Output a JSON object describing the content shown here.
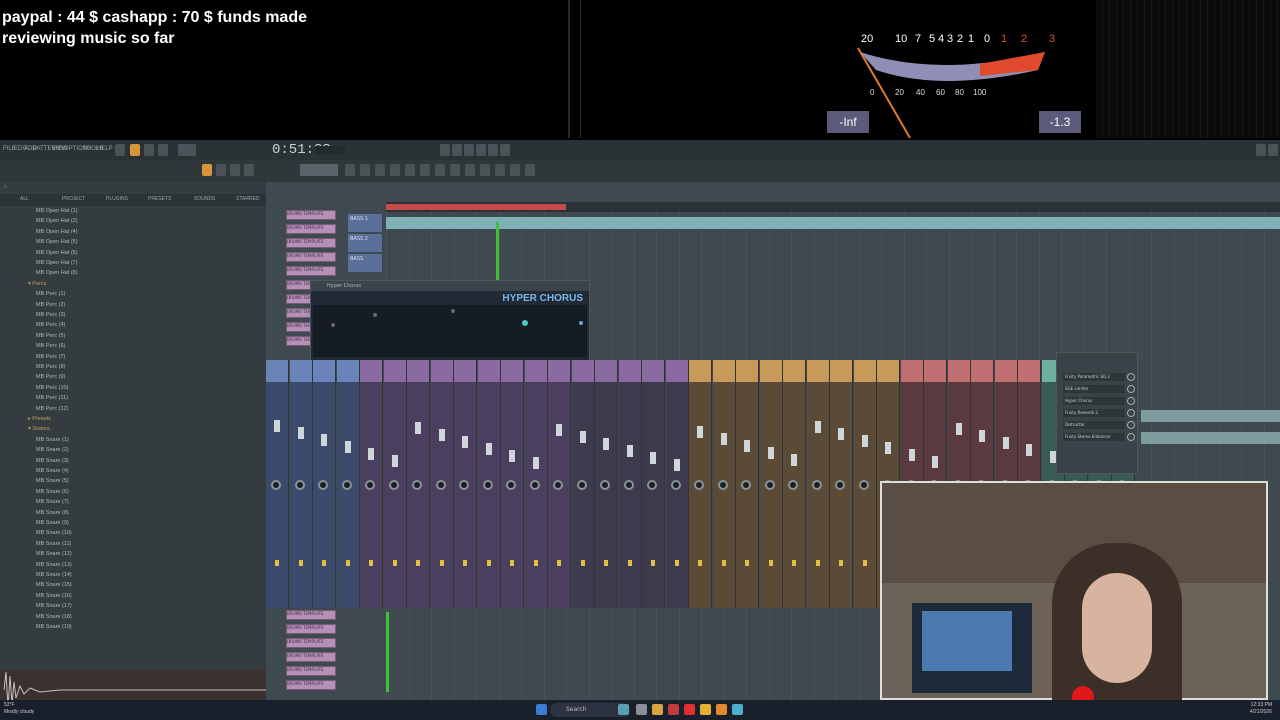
{
  "stream": {
    "funds_line1": "paypal : 44 $  cashapp : 70 $ funds made",
    "funds_line2": "reviewing music so far"
  },
  "vu_meter": {
    "scale_top": [
      "20",
      "10",
      "7",
      "5",
      "4",
      "3",
      "2",
      "1",
      "0",
      "1",
      "2",
      "3"
    ],
    "scale_bottom": [
      "0",
      "20",
      "40",
      "60",
      "80",
      "100"
    ],
    "left_readout": "-Inf",
    "right_readout": "-1.3",
    "needle_color": "#e07a2a"
  },
  "fl": {
    "menu": [
      "FILE",
      "EDIT",
      "ADD",
      "PATTERNS",
      "VIEW",
      "OPTIONS",
      "TOOLS",
      "HELP"
    ],
    "time": "0:51:??",
    "browser": {
      "tabs": [
        "ALL",
        "PROJECT",
        "PLUGINS",
        "PRESETS",
        "SOUNDS",
        "STARRED"
      ],
      "items_top": [
        "MB Open Hat (1)",
        "MB Open Hat (2)",
        "MB Open Hat (4)",
        "MB Open Hat (5)",
        "MB Open Hat (6)",
        "MB Open Hat (7)",
        "MB Open Hat (8)"
      ],
      "folder_percs": "Percs",
      "percs": [
        "MB Perc (1)",
        "MB Perc (2)",
        "MB Perc (3)",
        "MB Perc (4)",
        "MB Perc (5)",
        "MB Perc (6)",
        "MB Perc (7)",
        "MB Perc (8)",
        "MB Perc (9)",
        "MB Perc (10)",
        "MB Perc (11)",
        "MB Perc (12)"
      ],
      "folder_presets": "Presets",
      "folder_snares": "Snares",
      "snares": [
        "MB Snare (1)",
        "MB Snare (2)",
        "MB Snare (3)",
        "MB Snare (4)",
        "MB Snare (5)",
        "MB Snare (6)",
        "MB Snare (7)",
        "MB Snare (8)",
        "MB Snare (9)",
        "MB Snare (10)",
        "MB Snare (11)",
        "MB Snare (12)",
        "MB Snare (13)",
        "MB Snare (14)",
        "MB Snare (15)",
        "MB Snare (16)",
        "MB Snare (17)",
        "MB Snare (18)",
        "MB Snare (19)"
      ]
    },
    "playlist": {
      "track_labels": [
        "BASS 1",
        "BASS 2",
        "BASS"
      ],
      "clip_label": "DRUMS TEMPLATE"
    },
    "hyper_chorus": {
      "window_title": "Hyper Chorus",
      "plugin_title": "HYPER CHORUS"
    },
    "fx_rack": {
      "slots": [
        "Fruity Parametric EQ 2",
        "SGE Limiter",
        "Hyper Chorus",
        "Fruity Reeverb 2",
        "Distructor",
        "Fruity Stereo Enhancer"
      ]
    }
  },
  "taskbar": {
    "weather": "53°F",
    "weather_sub": "Mostly cloudy",
    "search": "Search",
    "time": "12:33 PM",
    "date": "4/21/2026"
  }
}
